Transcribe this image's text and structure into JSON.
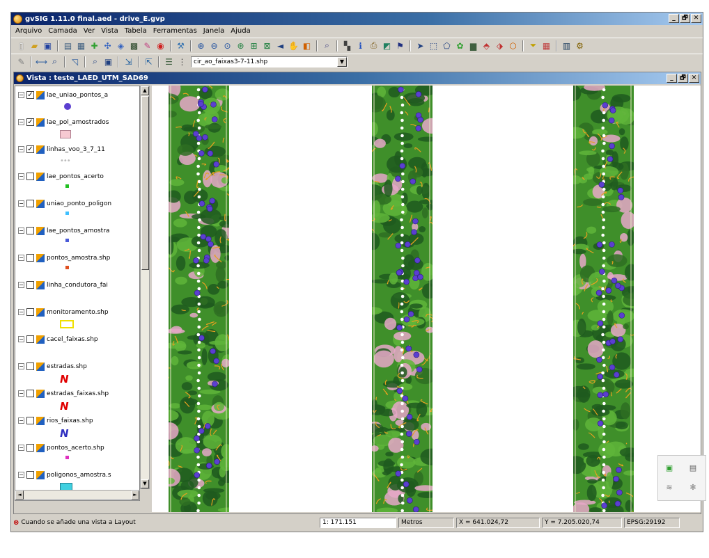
{
  "window": {
    "title": "gvSIG 1.11.0 final.aed - drive_E.gvp",
    "minimize": "_",
    "restore": "🗗",
    "close": "✕"
  },
  "menu": [
    "Arquivo",
    "Camada",
    "Ver",
    "Vista",
    "Tabela",
    "Ferramentas",
    "Janela",
    "Ajuda"
  ],
  "toolbar": {
    "active_layer": "cir_ao_faixas3-7-11.shp"
  },
  "view": {
    "title": "Vista : teste_LAED_UTM_SAD69",
    "minimize": "_",
    "restore": "🗗",
    "close": "✕"
  },
  "toc": {
    "layers": [
      {
        "name": "lae_uniao_pontos_a",
        "checked": true,
        "legend": "circle",
        "color": "#5b3fd0"
      },
      {
        "name": "lae_pol_amostrados",
        "checked": true,
        "legend": "rect",
        "color": "#f6c9d2"
      },
      {
        "name": "linhas_voo_3_7_11",
        "checked": true,
        "legend": "dots",
        "color": "#ffffff"
      },
      {
        "name": "lae_pontos_acerto",
        "checked": false,
        "legend": "dot",
        "color": "#22c022"
      },
      {
        "name": "uniao_ponto_poligon",
        "checked": false,
        "legend": "dot",
        "color": "#40c0ff"
      },
      {
        "name": "lae_pontos_amostra",
        "checked": false,
        "legend": "dot",
        "color": "#4a5ad8"
      },
      {
        "name": "pontos_amostra.shp",
        "checked": false,
        "legend": "dot",
        "color": "#e05020"
      },
      {
        "name": "linha_condutora_fai",
        "checked": false,
        "legend": "none",
        "color": "#000000"
      },
      {
        "name": "monitoramento.shp",
        "checked": false,
        "legend": "yrect",
        "color": "#f0e000"
      },
      {
        "name": "cacel_faixas.shp",
        "checked": false,
        "legend": "none",
        "color": "#000000"
      },
      {
        "name": "estradas.shp",
        "checked": false,
        "legend": "line",
        "color": "#e00000"
      },
      {
        "name": "estradas_faixas.shp",
        "checked": false,
        "legend": "line",
        "color": "#e00000"
      },
      {
        "name": "rios_faixas.shp",
        "checked": false,
        "legend": "line",
        "color": "#3030c0"
      },
      {
        "name": "pontos_acerto.shp",
        "checked": false,
        "legend": "dot",
        "color": "#e030c0"
      },
      {
        "name": "poligonos_amostra.s",
        "checked": false,
        "legend": "crect",
        "color": "#40d0e0"
      }
    ]
  },
  "status": {
    "message": "Cuando se añade una vista a Layout",
    "scale_prefix": "1:",
    "scale": "171.151",
    "units": "Metros",
    "x": "X = 641.024,72",
    "y": "Y = 7.205.020,74",
    "crs": "EPSG:29192"
  },
  "colors": {
    "vegetation_dark": "#1f5a1f",
    "vegetation": "#3f8f2a",
    "boundary": "#e8a020",
    "points": "#5b3fd0",
    "flight_line": "#ffffff"
  }
}
